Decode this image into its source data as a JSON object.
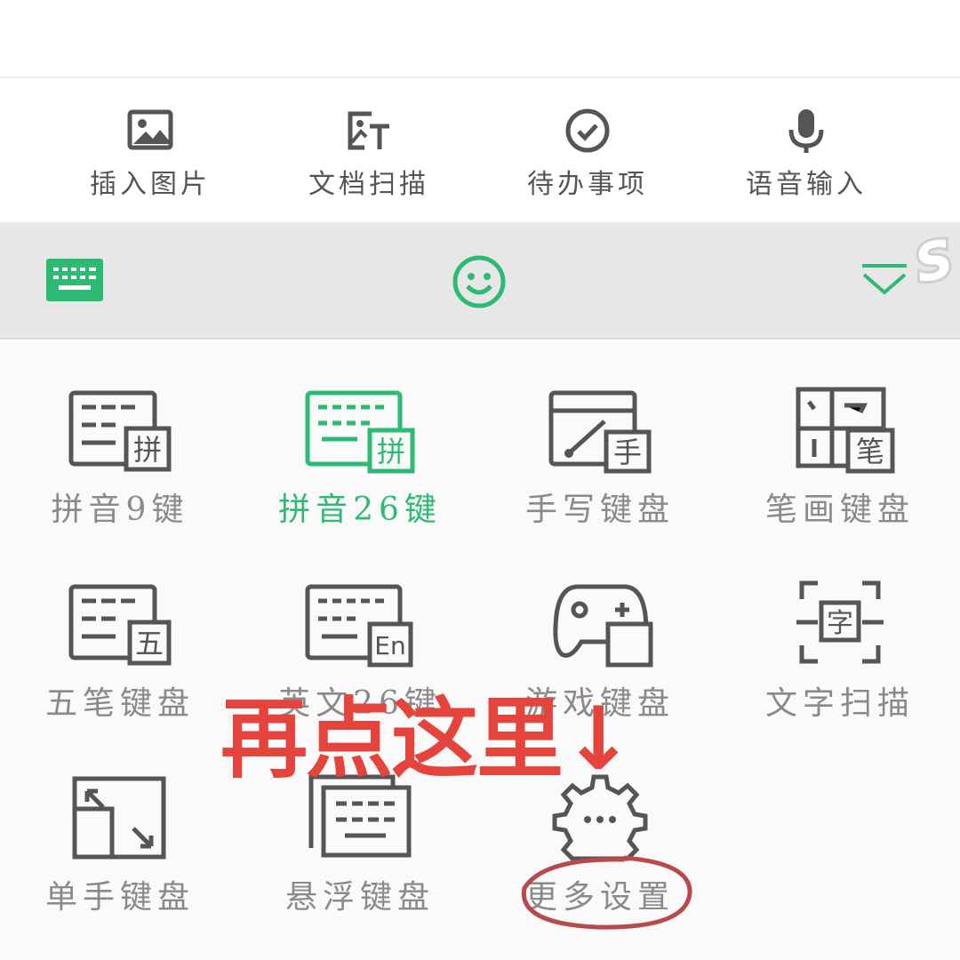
{
  "colors": {
    "accent": "#2dbb73",
    "icon": "#555555",
    "label": "#8a8a8a",
    "annotation": "#e5443c",
    "annotation_circle": "#b84a4a",
    "toggle_bar_bg": "#e7e7e7",
    "panel_bg": "#fafafa"
  },
  "toolbar": {
    "items": [
      {
        "label": "插入图片",
        "icon": "image-icon"
      },
      {
        "label": "文档扫描",
        "icon": "document-scan-icon"
      },
      {
        "label": "待办事项",
        "icon": "check-circle-icon"
      },
      {
        "label": "语音输入",
        "icon": "microphone-icon"
      }
    ]
  },
  "toggle_bar": {
    "left_icon": "keyboard-icon",
    "center_icon": "smiley-icon",
    "right_icon": "chevron-down-icon",
    "watermark": "S"
  },
  "keyboard_modes": [
    {
      "label": "拼音9键",
      "icon": "pinyin9-keyboard-icon",
      "badge": "拼",
      "active": false
    },
    {
      "label": "拼音26键",
      "icon": "pinyin26-keyboard-icon",
      "badge": "拼",
      "active": true
    },
    {
      "label": "手写键盘",
      "icon": "handwriting-keyboard-icon",
      "badge": "手",
      "active": false
    },
    {
      "label": "笔画键盘",
      "icon": "stroke-keyboard-icon",
      "badge": "笔",
      "active": false
    },
    {
      "label": "五笔键盘",
      "icon": "wubi-keyboard-icon",
      "badge": "五",
      "active": false
    },
    {
      "label": "英文26键",
      "icon": "english26-keyboard-icon",
      "badge": "En",
      "active": false
    },
    {
      "label": "游戏键盘",
      "icon": "game-keyboard-icon",
      "active": false
    },
    {
      "label": "文字扫描",
      "icon": "text-scan-icon",
      "badge": "字",
      "active": false
    },
    {
      "label": "单手键盘",
      "icon": "one-hand-keyboard-icon",
      "active": false
    },
    {
      "label": "悬浮键盘",
      "icon": "floating-keyboard-icon",
      "active": false
    },
    {
      "label": "更多设置",
      "icon": "settings-gear-icon",
      "active": false
    }
  ],
  "annotation": {
    "text": "再点这里↓"
  }
}
